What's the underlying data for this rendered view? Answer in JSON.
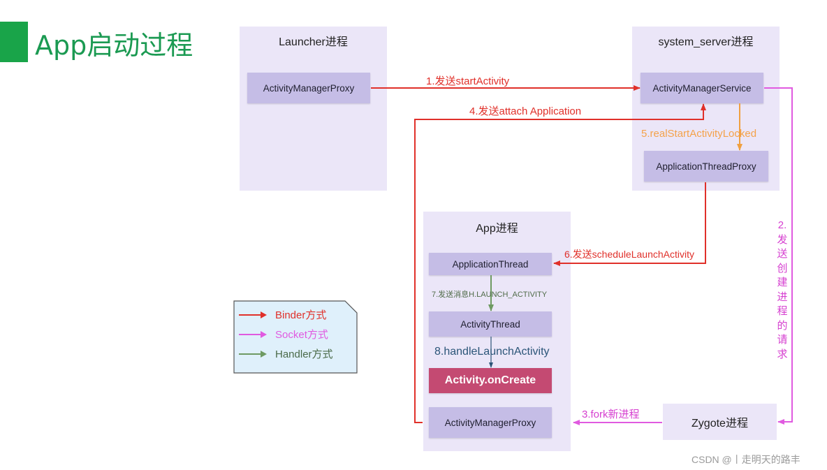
{
  "title": "App启动过程",
  "colors": {
    "binder": "#e0302a",
    "socket": "#e05ae0",
    "handler": "#6e9a62",
    "realstart": "#f4a24a",
    "handle_launch": "#2b5578",
    "process_bg": "#ebe6f8",
    "node_bg": "#c5bde6",
    "create_bg": "#c44a72",
    "title_green": "#1b9a52"
  },
  "processes": {
    "launcher": {
      "label": "Launcher进程",
      "nodes": [
        "ActivityManagerProxy"
      ]
    },
    "system_server": {
      "label": "system_server进程",
      "nodes": [
        "ActivityManagerService",
        "ApplicationThreadProxy"
      ]
    },
    "app": {
      "label": "App进程",
      "nodes": [
        "ApplicationThread",
        "ActivityThread",
        "Activity.onCreate",
        "ActivityManagerProxy"
      ]
    },
    "zygote": {
      "label": "Zygote进程"
    }
  },
  "edges": {
    "step1": "1.发送startActivity",
    "step2_chars": [
      "2.",
      "发",
      "送",
      "创",
      "建",
      "进",
      "程",
      "的",
      "请",
      "求"
    ],
    "step3": "3.fork新进程",
    "step4": "4.发送attach Application",
    "step5": "5.realStartActivityLocked",
    "step6": "6.发送scheduleLaunchActivity",
    "step7": "7.发送消息H.LAUNCH_ACTIVITY",
    "step8": "8.handleLaunchActivity"
  },
  "legend": [
    {
      "label": "Binder方式",
      "type": "binder"
    },
    {
      "label": "Socket方式",
      "type": "socket"
    },
    {
      "label": "Handler方式",
      "type": "handler"
    }
  ],
  "watermark": "CSDN @丨走明天的路丰"
}
